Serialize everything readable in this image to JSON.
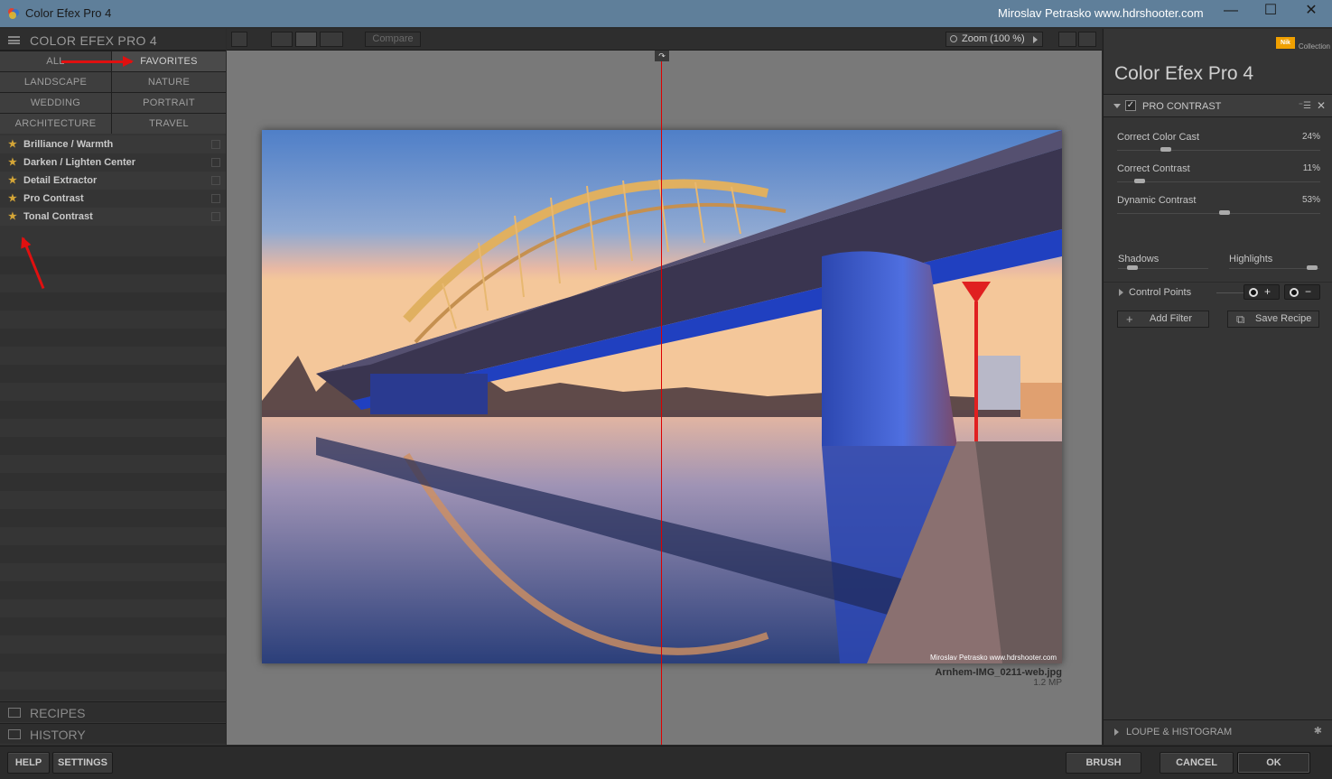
{
  "window": {
    "title": "Color Efex Pro 4",
    "owner": "Miroslav  Petrasko  www.hdrshooter.com",
    "minimize": "—",
    "maximize": "☐",
    "close": "✕"
  },
  "left_panel": {
    "header": "COLOR EFEX PRO 4",
    "categories": [
      "ALL",
      "FAVORITES",
      "LANDSCAPE",
      "NATURE",
      "WEDDING",
      "PORTRAIT",
      "ARCHITECTURE",
      "TRAVEL"
    ],
    "filters": [
      "Brilliance / Warmth",
      "Darken / Lighten Center",
      "Detail Extractor",
      "Pro Contrast",
      "Tonal Contrast"
    ],
    "recipes": "RECIPES",
    "history": "HISTORY"
  },
  "toolbar": {
    "compare": "Compare",
    "zoom": "Zoom (100 %)"
  },
  "canvas": {
    "photo_credit": "Miroslav Petrasko www.hdrshooter.com",
    "file_name": "Arnhem-IMG_0211-web.jpg",
    "file_size": "1.2 MP",
    "split_handle": "↷"
  },
  "right_panel": {
    "brand": "Nik",
    "brand_sub": "Collection",
    "app_title": "Color Efex Pro  4",
    "filter_name": "PRO CONTRAST",
    "filter_menu": "⁻☰",
    "filter_close": "✕",
    "filter_check": "✓",
    "sliders": [
      {
        "label": "Correct Color Cast",
        "value": "24%",
        "fraction": 0.24
      },
      {
        "label": "Correct Contrast",
        "value": "11%",
        "fraction": 0.11
      },
      {
        "label": "Dynamic Contrast",
        "value": "53%",
        "fraction": 0.53
      }
    ],
    "shadows": "Shadows",
    "highlights": "Highlights",
    "control_points": "Control Points",
    "cp_add": "+",
    "cp_remove": "−",
    "add_filter": "Add Filter",
    "add_icon": "+",
    "save_recipe": "Save Recipe",
    "save_icon": "⧉",
    "loupe": "LOUPE & HISTOGRAM",
    "loupe_pin": "✱"
  },
  "bottom": {
    "help": "HELP",
    "settings": "SETTINGS",
    "brush": "BRUSH",
    "cancel": "CANCEL",
    "ok": "OK"
  },
  "colors": {
    "titlebar": "#5f7f9a",
    "star": "#d4a537",
    "annotation": "#e01010",
    "split_line": "#dd0000"
  }
}
